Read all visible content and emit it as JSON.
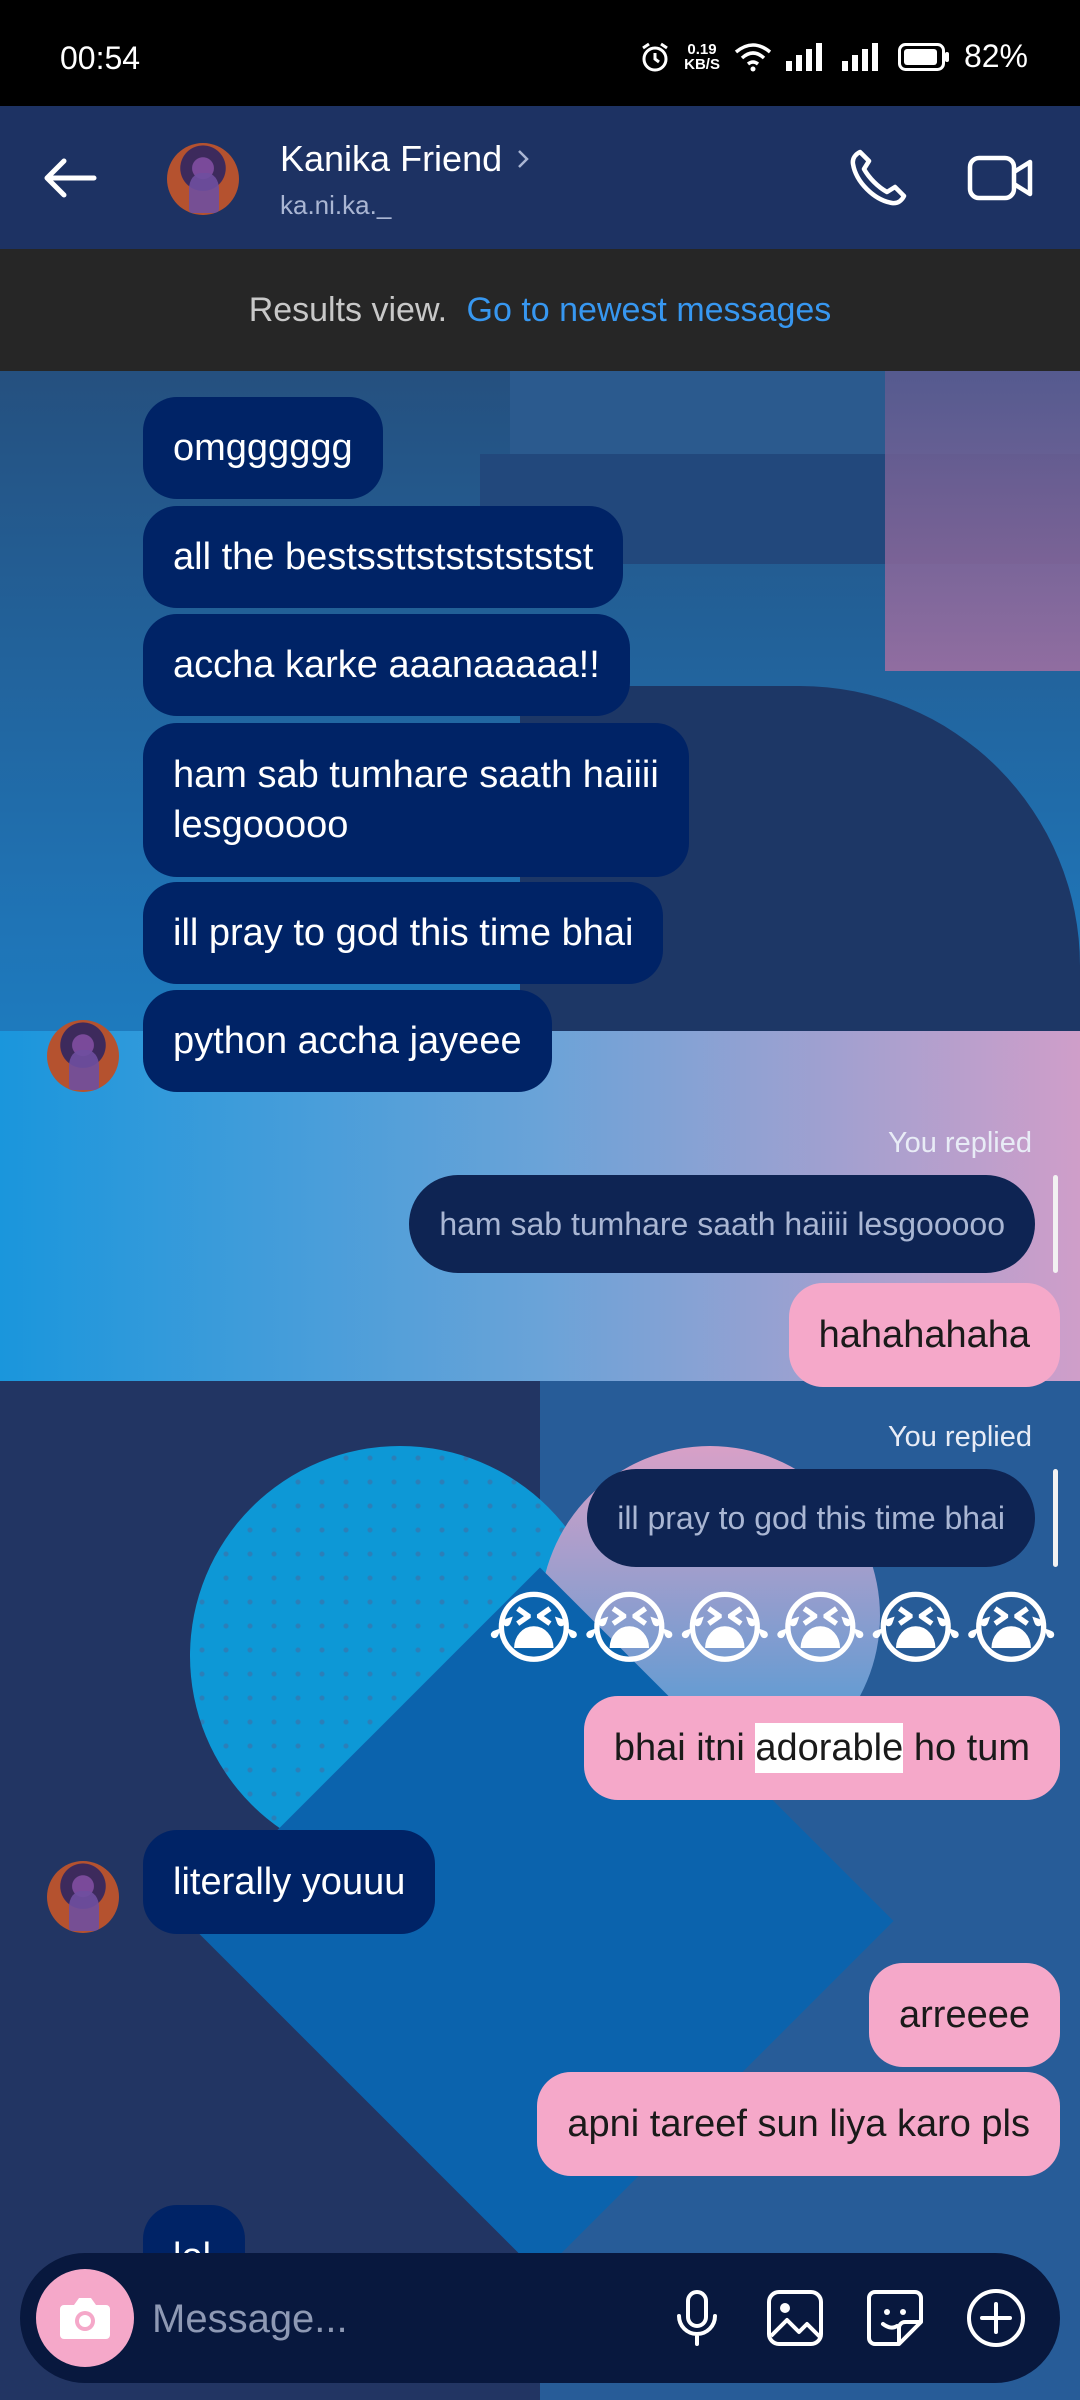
{
  "status_bar": {
    "time": "00:54",
    "net_speed_value": "0.19",
    "net_speed_unit": "KB/S",
    "battery": "82%"
  },
  "header": {
    "contact_name": "Kanika Friend",
    "contact_handle": "ka.ni.ka._"
  },
  "results_banner": {
    "label": "Results view.",
    "link": "Go to newest messages"
  },
  "messages": [
    {
      "from": "them",
      "text": "omgggggg"
    },
    {
      "from": "them",
      "text": "all the bestssttstststststst"
    },
    {
      "from": "them",
      "text": "accha karke aaanaaaaa!!"
    },
    {
      "from": "them",
      "text": "ham sab tumhare saath haiiii",
      "text2": "lesgooooo"
    },
    {
      "from": "them",
      "text": "ill pray to god this time bhai"
    },
    {
      "from": "them",
      "text": "python accha jayeee"
    },
    {
      "from": "me",
      "reply_label": "You replied",
      "quoted": "ham sab tumhare saath haiiii lesgooooo",
      "text": "hahahahaha"
    },
    {
      "from": "me",
      "reply_label": "You replied",
      "quoted": "ill pray to god this time bhai",
      "text": "😭😭😭😭😭😭"
    },
    {
      "from": "me",
      "text_before": "bhai itni ",
      "highlight": "adorable",
      "text_after": " ho tum"
    },
    {
      "from": "them",
      "text": "literally youuu"
    },
    {
      "from": "me",
      "text": "arreeee"
    },
    {
      "from": "me",
      "text": "apni tareef sun liya karo pls"
    },
    {
      "from": "them",
      "text": "lol"
    }
  ],
  "composer": {
    "placeholder": "Message..."
  },
  "colors": {
    "received_bubble": "#002366",
    "sent_bubble": "#f5a8c9",
    "link": "#3797f0",
    "header_bg": "#1d3263"
  }
}
